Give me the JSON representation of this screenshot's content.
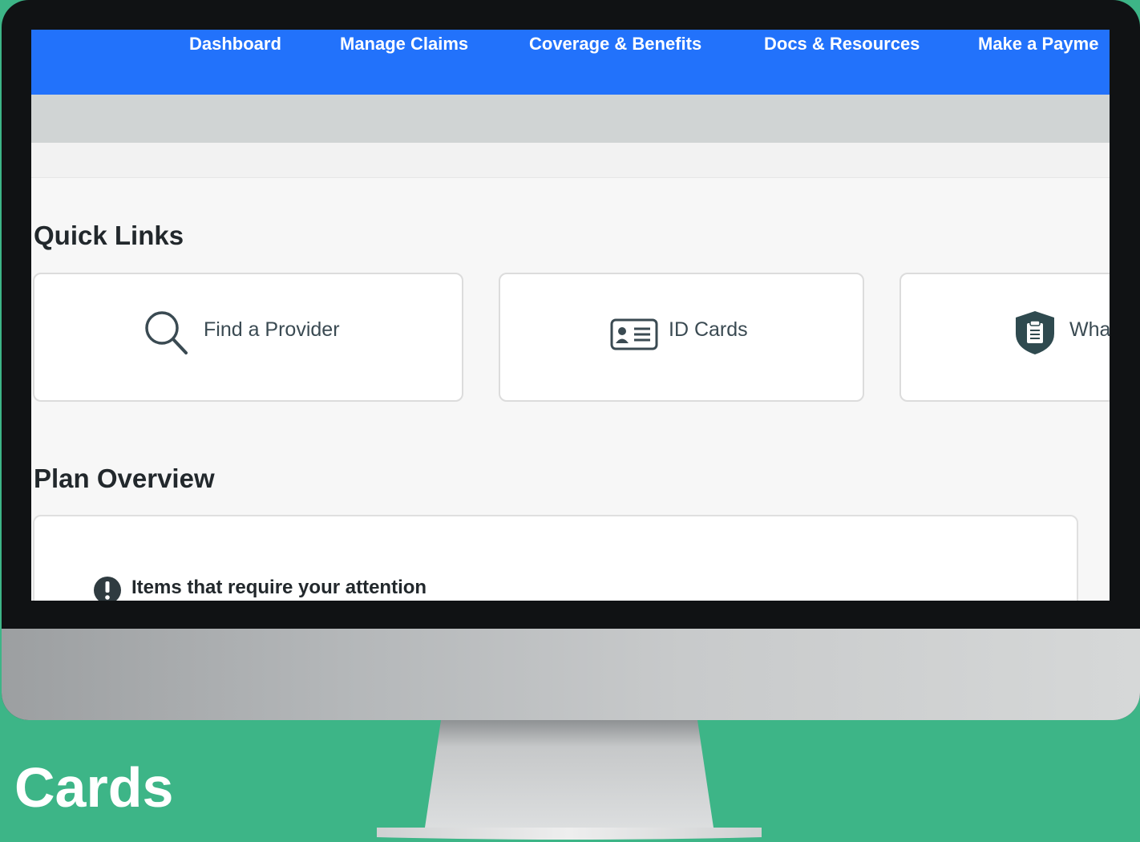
{
  "theme": {
    "background": "#3db587",
    "nav_color": "#2272fb",
    "screen_bg": "#f7f7f7"
  },
  "nav": {
    "items": [
      {
        "label": "Dashboard"
      },
      {
        "label": "Manage Claims"
      },
      {
        "label": "Coverage & Benefits"
      },
      {
        "label": "Docs & Resources"
      },
      {
        "label": "Make a Payme"
      }
    ]
  },
  "quick_links": {
    "title": "Quick Links",
    "cards": [
      {
        "label": "Find a Provider",
        "icon": "search-icon"
      },
      {
        "label": "ID Cards",
        "icon": "id-card-icon"
      },
      {
        "label": "Wha",
        "icon": "clipboard-shield-icon"
      }
    ]
  },
  "plan_overview": {
    "title": "Plan Overview",
    "attention": "Items that require your attention",
    "attention_icon": "exclamation-icon"
  },
  "caption": {
    "text": "D Cards"
  }
}
